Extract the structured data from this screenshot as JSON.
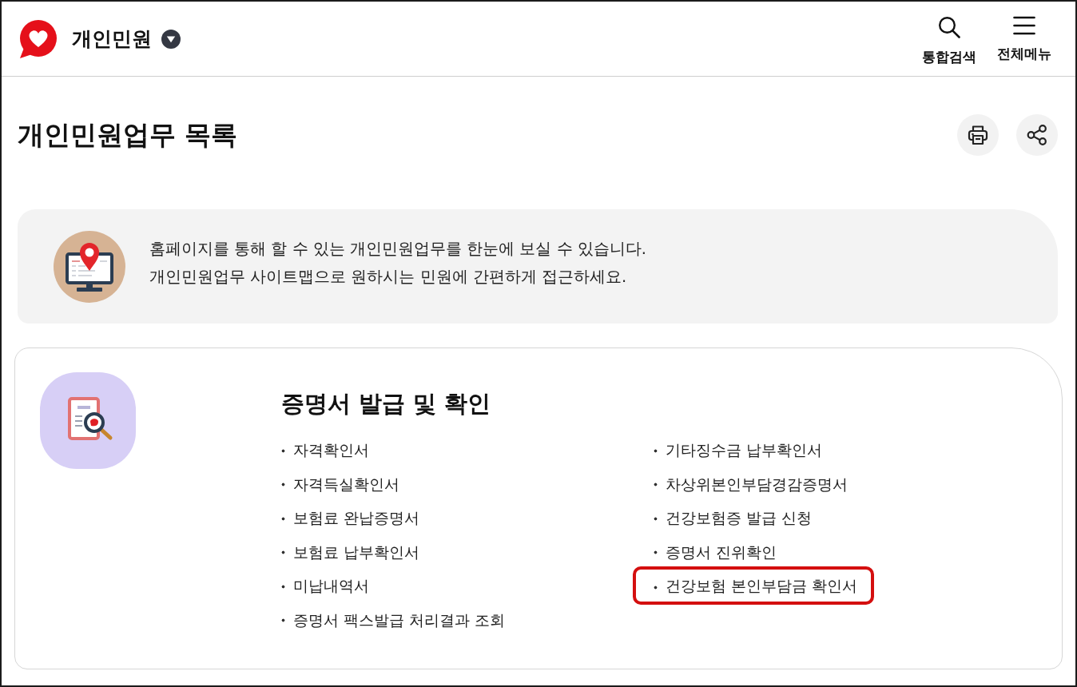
{
  "header": {
    "title": "개인민원",
    "actions": [
      {
        "kind": "search",
        "label": "통합검색"
      },
      {
        "kind": "menu",
        "label": "전체메뉴"
      }
    ]
  },
  "page_title": {
    "title": "개인민원업무 목록",
    "tools": [
      {
        "kind": "print"
      },
      {
        "kind": "share"
      }
    ]
  },
  "intro": {
    "lines": [
      "홈페이지를 통해 할 수 있는 개인민원업무를 한눈에 보실 수 있습니다.",
      "개인민원업무 사이트맵으로 원하시는 민원에 간편하게 접근하세요."
    ]
  },
  "section": {
    "title": "증명서 발급 및 확인",
    "columns": [
      {
        "items": [
          {
            "label": "자격확인서",
            "highlighted": false
          },
          {
            "label": "자격득실확인서",
            "highlighted": false
          },
          {
            "label": "보험료 완납증명서",
            "highlighted": false
          },
          {
            "label": "보험료 납부확인서",
            "highlighted": false
          },
          {
            "label": "미납내역서",
            "highlighted": false
          },
          {
            "label": "증명서 팩스발급 처리결과 조회",
            "highlighted": false
          }
        ]
      },
      {
        "items": [
          {
            "label": "기타징수금 납부확인서",
            "highlighted": false
          },
          {
            "label": "차상위본인부담경감증명서",
            "highlighted": false
          },
          {
            "label": "건강보험증 발급 신청",
            "highlighted": false
          },
          {
            "label": "증명서 진위확인",
            "highlighted": false
          },
          {
            "label": "건강보험 본인부담금 확인서",
            "highlighted": true
          }
        ]
      }
    ]
  }
}
